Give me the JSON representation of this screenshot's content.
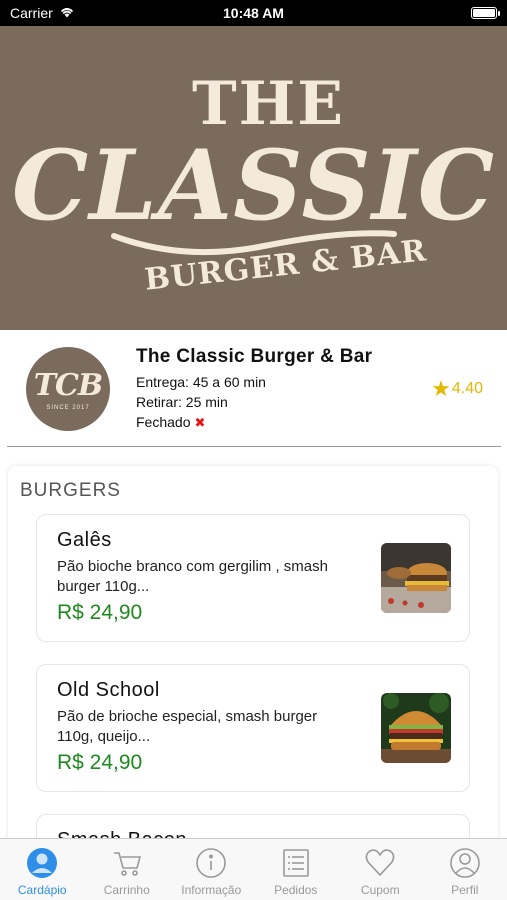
{
  "status_bar": {
    "carrier": "Carrier",
    "time": "10:48 AM",
    "wifi_icon": "wifi-icon",
    "battery_icon": "battery-icon",
    "battery_level": 1.0
  },
  "banner": {
    "line1": "THE",
    "line2": "CLASSIC",
    "line3": "BURGER & BAR"
  },
  "restaurant": {
    "logo_text": "TCB",
    "logo_subtext": "SINCE 2017",
    "name": "The Classic Burger & Bar",
    "delivery": "Entrega: 45 a 60 min",
    "pickup": "Retirar: 25 min",
    "status": "Fechado",
    "rating": "4.40",
    "colors": {
      "brand": "#7a6b5c",
      "rating": "#e3b800",
      "closed": "#ee1111"
    }
  },
  "menu": {
    "category": "BURGERS",
    "items": [
      {
        "name": "Galês",
        "description": "Pão bioche branco com gergilim , smash burger 110g...",
        "price": "R$ 24,90"
      },
      {
        "name": "Old School",
        "description": "Pão de brioche especial, smash burger 110g, queijo...",
        "price": "R$ 24,90"
      },
      {
        "name": "Smash Bacon",
        "description": "",
        "price": ""
      }
    ],
    "price_color": "#1f8a1f"
  },
  "tab_bar": {
    "active_color": "#2f8ee8",
    "tabs": [
      {
        "label": "Cardápio",
        "icon": "person-icon",
        "active": true
      },
      {
        "label": "Carrinho",
        "icon": "cart-icon",
        "active": false
      },
      {
        "label": "Informação",
        "icon": "info-icon",
        "active": false
      },
      {
        "label": "Pedidos",
        "icon": "list-icon",
        "active": false
      },
      {
        "label": "Cupom",
        "icon": "heart-icon",
        "active": false
      },
      {
        "label": "Perfil",
        "icon": "profile-icon",
        "active": false
      }
    ]
  }
}
